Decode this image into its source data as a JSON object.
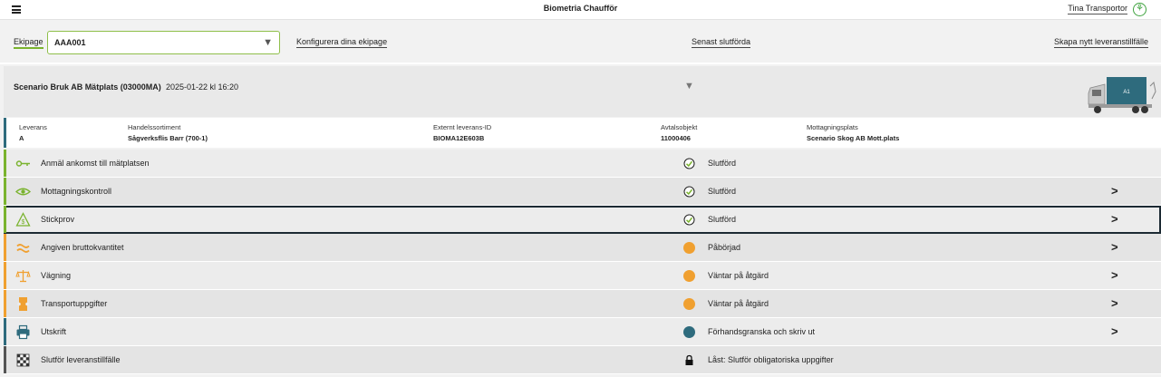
{
  "header": {
    "app_title": "Biometria Chaufför",
    "user_name": "Tina Transportor"
  },
  "ekipage_bar": {
    "label": "Ekipage",
    "selected": "AAA001",
    "configure_link": "Konfigurera dina ekipage",
    "recent_link": "Senast slutförda",
    "create_link": "Skapa nytt leveranstillfälle"
  },
  "scenario": {
    "name": "Scenario Bruk AB Mätplats (03000MA)",
    "datetime": "2025-01-22 kl 16:20",
    "truck_label": "A1"
  },
  "details": {
    "leverans_label": "Leverans",
    "leverans_value": "A",
    "sortiment_label": "Handelssortiment",
    "sortiment_value": "Sågverksflis Barr (700-1)",
    "extern_label": "Externt leverans-ID",
    "extern_value": "BIOMA12E603B",
    "avtal_label": "Avtalsobjekt",
    "avtal_value": "11000406",
    "mottagning_label": "Mottagningsplats",
    "mottagning_value": "Scenario Skog AB Mott.plats"
  },
  "steps": [
    {
      "title": "Anmäl ankomst till mätplatsen",
      "status": "Slutförd",
      "icon": "key-icon",
      "state": "done"
    },
    {
      "title": "Mottagningskontroll",
      "status": "Slutförd",
      "icon": "eye-icon",
      "state": "done"
    },
    {
      "title": "Stickprov",
      "status": "Slutförd",
      "icon": "sample-icon",
      "state": "done"
    },
    {
      "title": "Angiven bruttokvantitet",
      "status": "Påbörjad",
      "icon": "approx-icon",
      "state": "started"
    },
    {
      "title": "Vägning",
      "status": "Väntar på åtgärd",
      "icon": "scale-icon",
      "state": "waiting"
    },
    {
      "title": "Transportuppgifter",
      "status": "Väntar på åtgärd",
      "icon": "transport-icon",
      "state": "waiting"
    },
    {
      "title": "Utskrift",
      "status": "Förhandsgranska och skriv ut",
      "icon": "printer-icon",
      "state": "print"
    },
    {
      "title": "Slutför leveranstillfälle",
      "status": "Låst: Slutför obligatoriska uppgifter",
      "icon": "checkered-flag-icon",
      "state": "locked"
    }
  ],
  "colors": {
    "green": "#7ab32e",
    "orange": "#f0a030",
    "teal": "#2e6b7d"
  }
}
